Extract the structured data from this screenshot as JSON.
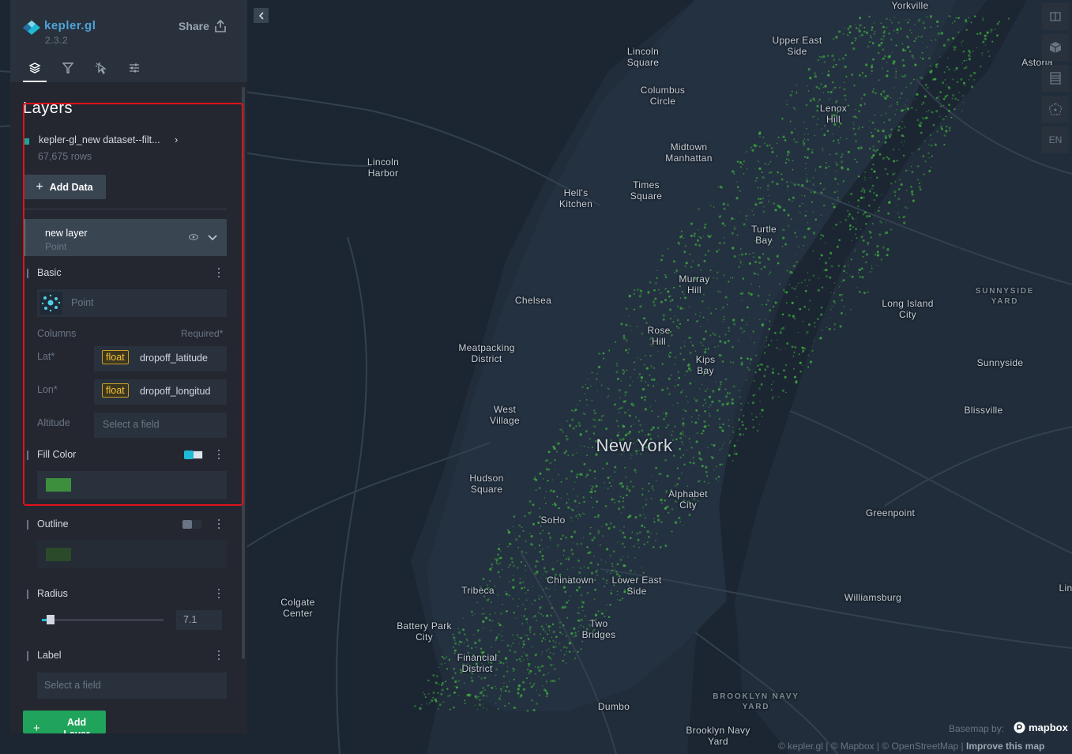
{
  "app": {
    "name": "kepler.gl",
    "version": "2.3.2",
    "share_label": "Share"
  },
  "tabs": [
    {
      "icon": "layers-icon"
    },
    {
      "icon": "filter-icon"
    },
    {
      "icon": "interaction-icon"
    },
    {
      "icon": "map-settings-icon"
    }
  ],
  "layers_panel": {
    "title": "Layers",
    "dataset": {
      "name": "kepler-gl_new dataset--filt...",
      "rows": "67,675 rows",
      "color": "#19a5a0"
    },
    "add_data_label": "Add Data",
    "layer": {
      "name": "new layer",
      "type": "Point",
      "basic_label": "Basic",
      "type_select_label": "Point",
      "columns_label": "Columns",
      "required_label": "Required*",
      "lat_label": "Lat*",
      "lat_type": "float",
      "lat_field": "dropoff_latitude",
      "lon_label": "Lon*",
      "lon_type": "float",
      "lon_field": "dropoff_longitud",
      "altitude_label": "Altitude",
      "altitude_placeholder": "Select a field",
      "fill_color_label": "Fill Color",
      "fill_color": "#3d8f3d",
      "outline_label": "Outline",
      "outline_color": "#2a4a2a",
      "radius_label": "Radius",
      "radius_value": "7.1",
      "label_label": "Label",
      "label_placeholder": "Select a field"
    },
    "add_layer_label": "Add Layer"
  },
  "map": {
    "labels": [
      "Yorkville",
      "Upper East Side",
      "Lincoln Square",
      "Astoria",
      "Columbus Circle",
      "Lenox Hill",
      "Midtown Manhattan",
      "Lincoln Harbor",
      "Hell's Kitchen",
      "Times Square",
      "Turtle Bay",
      "Murray Hill",
      "SUNNYSIDE YARD",
      "Chelsea",
      "Long Island City",
      "Meatpacking District",
      "Rose Hill",
      "Kips Bay",
      "Sunnyside",
      "Blissville",
      "West Village",
      "New York",
      "Hudson Square",
      "Alphabet City",
      "SoHo",
      "Greenpoint",
      "Tribeca",
      "Chinatown",
      "Lower East Side",
      "Colgate Center",
      "Williamsburg",
      "Lin",
      "Battery Park City",
      "Two Bridges",
      "Financial District",
      "Dumbo",
      "BROOKLYN NAVY YARD",
      "Brooklyn Navy Yard"
    ],
    "point_color": "#3fae3f",
    "background_color": "#212d3a",
    "water_color": "#1c2733"
  },
  "map_controls": [
    {
      "icon": "split-map-icon"
    },
    {
      "icon": "3d-view-icon"
    },
    {
      "icon": "legend-icon"
    },
    {
      "icon": "draw-polygon-icon"
    },
    {
      "label": "EN"
    }
  ],
  "attribution": {
    "basemap_by": "Basemap by:",
    "mapbox": "mapbox",
    "text": "© kepler.gl | © Mapbox | © OpenStreetMap |",
    "improve": "Improve this map"
  }
}
